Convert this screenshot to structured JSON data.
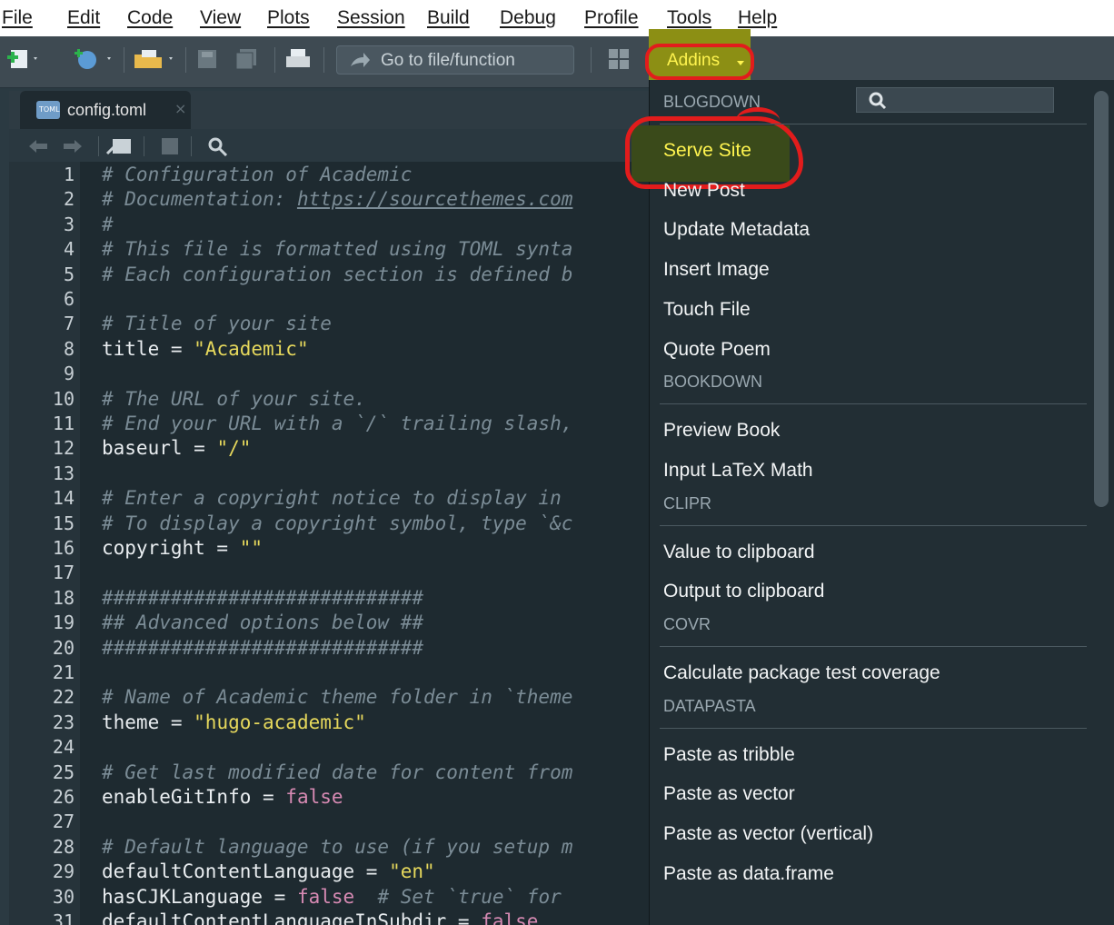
{
  "menubar": {
    "items": [
      "File",
      "Edit",
      "Code",
      "View",
      "Plots",
      "Session",
      "Build",
      "Debug",
      "Profile",
      "Tools",
      "Help"
    ]
  },
  "toolbar": {
    "goto_label": "Go to file/function",
    "addins_label": "Addins"
  },
  "tab": {
    "icon_text": "TOML",
    "name": "config.toml",
    "close": "×"
  },
  "editor": {
    "lines": [
      {
        "n": "1",
        "t": [
          {
            "k": "com",
            "v": "# Configuration of Academic"
          }
        ]
      },
      {
        "n": "2",
        "t": [
          {
            "k": "com",
            "v": "# Documentation: "
          },
          {
            "k": "link",
            "v": "https://sourcethemes.com"
          }
        ]
      },
      {
        "n": "3",
        "t": [
          {
            "k": "com",
            "v": "#"
          }
        ]
      },
      {
        "n": "4",
        "t": [
          {
            "k": "com",
            "v": "# This file is formatted using TOML synta"
          }
        ]
      },
      {
        "n": "5",
        "t": [
          {
            "k": "com",
            "v": "# Each configuration section is defined b"
          }
        ]
      },
      {
        "n": "6",
        "t": []
      },
      {
        "n": "7",
        "t": [
          {
            "k": "com",
            "v": "# Title of your site"
          }
        ]
      },
      {
        "n": "8",
        "t": [
          {
            "k": "id",
            "v": "title = "
          },
          {
            "k": "str",
            "v": "\"Academic\""
          }
        ]
      },
      {
        "n": "9",
        "t": []
      },
      {
        "n": "10",
        "t": [
          {
            "k": "com",
            "v": "# The URL of your site."
          }
        ]
      },
      {
        "n": "11",
        "t": [
          {
            "k": "com",
            "v": "# End your URL with a `/` trailing slash,"
          }
        ]
      },
      {
        "n": "12",
        "t": [
          {
            "k": "id",
            "v": "baseurl = "
          },
          {
            "k": "str",
            "v": "\"/\""
          }
        ]
      },
      {
        "n": "13",
        "t": []
      },
      {
        "n": "14",
        "t": [
          {
            "k": "com",
            "v": "# Enter a copyright notice to display in"
          }
        ]
      },
      {
        "n": "15",
        "t": [
          {
            "k": "com",
            "v": "# To display a copyright symbol, type `&c"
          }
        ]
      },
      {
        "n": "16",
        "t": [
          {
            "k": "id",
            "v": "copyright = "
          },
          {
            "k": "str",
            "v": "\"\""
          }
        ]
      },
      {
        "n": "17",
        "t": []
      },
      {
        "n": "18",
        "t": [
          {
            "k": "com",
            "v": "############################"
          }
        ]
      },
      {
        "n": "19",
        "t": [
          {
            "k": "com",
            "v": "## Advanced options below ##"
          }
        ]
      },
      {
        "n": "20",
        "t": [
          {
            "k": "com",
            "v": "############################"
          }
        ]
      },
      {
        "n": "21",
        "t": []
      },
      {
        "n": "22",
        "t": [
          {
            "k": "com",
            "v": "# Name of Academic theme folder in `theme"
          }
        ]
      },
      {
        "n": "23",
        "t": [
          {
            "k": "id",
            "v": "theme = "
          },
          {
            "k": "str",
            "v": "\"hugo-academic\""
          }
        ]
      },
      {
        "n": "24",
        "t": []
      },
      {
        "n": "25",
        "t": [
          {
            "k": "com",
            "v": "# Get last modified date for content from"
          }
        ]
      },
      {
        "n": "26",
        "t": [
          {
            "k": "id",
            "v": "enableGitInfo = "
          },
          {
            "k": "kw",
            "v": "false"
          }
        ]
      },
      {
        "n": "27",
        "t": []
      },
      {
        "n": "28",
        "t": [
          {
            "k": "com",
            "v": "# Default language to use (if you setup m"
          }
        ]
      },
      {
        "n": "29",
        "t": [
          {
            "k": "id",
            "v": "defaultContentLanguage = "
          },
          {
            "k": "str",
            "v": "\"en\""
          }
        ]
      },
      {
        "n": "30",
        "t": [
          {
            "k": "id",
            "v": "hasCJKLanguage = "
          },
          {
            "k": "kw",
            "v": "false"
          },
          {
            "k": "com",
            "v": "  # Set `true` for"
          }
        ]
      },
      {
        "n": "31",
        "t": [
          {
            "k": "id",
            "v": "defaultContentLanguageInSubdir = "
          },
          {
            "k": "kw",
            "v": "false"
          }
        ]
      }
    ]
  },
  "addins": {
    "groups": [
      {
        "header": "BLOGDOWN",
        "items": [
          "Serve Site",
          "New Post",
          "Update Metadata",
          "Insert Image",
          "Touch File",
          "Quote Poem"
        ]
      },
      {
        "header": "BOOKDOWN",
        "items": [
          "Preview Book",
          "Input LaTeX Math"
        ]
      },
      {
        "header": "CLIPR",
        "items": [
          "Value to clipboard",
          "Output to clipboard"
        ]
      },
      {
        "header": "COVR",
        "items": [
          "Calculate package test coverage"
        ]
      },
      {
        "header": "DATAPASTA",
        "items": [
          "Paste as tribble",
          "Paste as vector",
          "Paste as vector (vertical)",
          "Paste as data.frame"
        ]
      }
    ],
    "highlighted_item": "Serve Site"
  },
  "colors": {
    "highlight_text": "#fff44f",
    "annotation_red": "#e21c1c",
    "editor_bg": "#1e2a30"
  }
}
